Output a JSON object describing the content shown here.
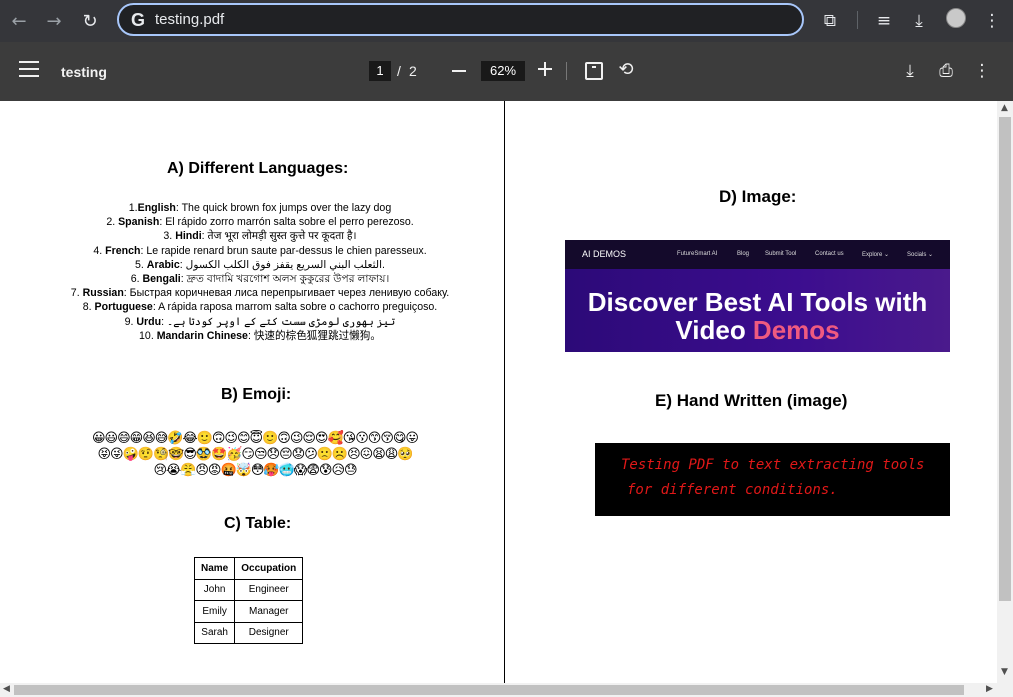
{
  "browser": {
    "url": "testing.pdf",
    "search_logo": "G"
  },
  "pdf_toolbar": {
    "title": "testing",
    "current_page": "1",
    "page_separator": "/",
    "total_pages": "2",
    "zoom": "62%"
  },
  "page1": {
    "sec_a": "A)   Different Languages:",
    "languages": [
      {
        "num": "1.",
        "name": "English",
        "text": ": The quick brown fox jumps over the lazy dog"
      },
      {
        "num": "2. ",
        "name": "Spanish",
        "text": ": El rápido zorro marrón salta sobre el perro perezoso."
      },
      {
        "num": "3. ",
        "name": "Hindi",
        "text": ": तेज भूरा लोमड़ी सुस्त कुत्ते पर कूदता है।"
      },
      {
        "num": "4. ",
        "name": "French",
        "text": ": Le rapide renard brun saute par-dessus le chien paresseux."
      },
      {
        "num": "5. ",
        "name": "Arabic",
        "text": ": الثعلب البني السريع يقفز فوق الكلب الكسول."
      },
      {
        "num": "6. ",
        "name": "Bengali",
        "text": ": দ্রুত বাদামি খরগোশ অলস কুকুরের উপর লাফায়।"
      },
      {
        "num": "7. ",
        "name": "Russian",
        "text": ": Быстрая коричневая лиса перепрыгивает через ленивую собаку."
      },
      {
        "num": "8. ",
        "name": "Portuguese",
        "text": ": A rápida raposa marrom salta sobre o cachorro preguiçoso."
      },
      {
        "num": "9. ",
        "name": "Urdu",
        "text": ": تیز بھوری لومڑی سست کتے کے اوپر کودتا ہے۔"
      },
      {
        "num": "10. ",
        "name": "Mandarin Chinese",
        "text": ": 快速的棕色狐狸跳过懒狗。"
      }
    ],
    "sec_b": "B)   Emoji:",
    "emoji_lines": [
      "😀😃😄😁😆😅🤣😂🙂🙃😉😊😇🙂🙃😉😌😍🥰😘😗😙😚😋😛",
      "😝😜🤪🤨🧐🤓😎🥸🤩🥳😏😒😞😔😟😕🙁☹️😣😖😫😩🥺",
      "😢😭😤😠😡🤬🤯😳🥵🥶😱😨😰😥😓"
    ],
    "sec_c": "C)   Table:",
    "table": {
      "headers": [
        "Name",
        "Occupation"
      ],
      "rows": [
        [
          "John",
          "Engineer"
        ],
        [
          "Emily",
          "Manager"
        ],
        [
          "Sarah",
          "Designer"
        ]
      ]
    }
  },
  "page2": {
    "sec_d": "D)  Image:",
    "banner": {
      "logo": "AI DEMOS",
      "nav": [
        "FutureSmart AI",
        "Blog",
        "Submit Tool",
        "Contact us",
        "Explore ⌄",
        "Socials ⌄"
      ],
      "headline_line1": "Discover Best AI Tools with",
      "headline_word_plain": "Video ",
      "headline_word_hl": "Demos"
    },
    "sec_e": "E)  Hand Written (image)",
    "handwritten_line1": "Testing PDF to text extracting tools",
    "handwritten_line2": "for different conditions."
  },
  "colors": {
    "chrome_bg": "#35363a",
    "pdf_toolbar_bg": "#3c3c3c",
    "omnibox_focus": "#a8c7fa",
    "banner_purple": "#3c0d8f",
    "banner_accent": "#ef5a80",
    "handwriting_red": "#e01818"
  }
}
